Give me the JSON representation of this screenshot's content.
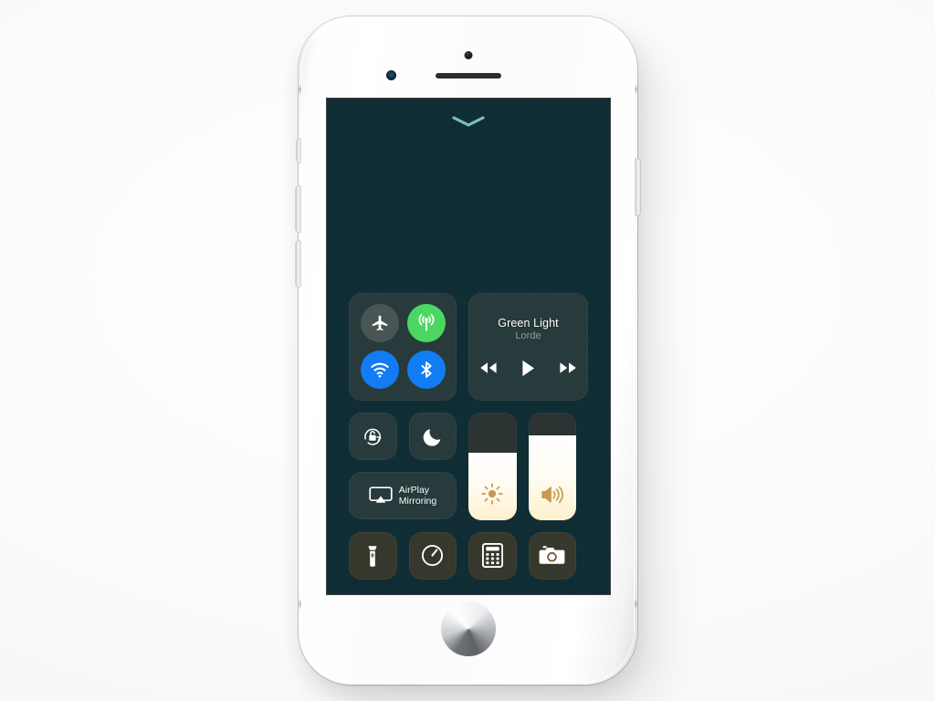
{
  "device": {
    "name": "iPhone",
    "finish": "silver-white",
    "components": {
      "front_camera": "front-camera",
      "earpiece": "earpiece-speaker",
      "proximity_sensor": "proximity-sensor",
      "home_button": "home-button",
      "power_button": "power-button",
      "volume_up_button": "volume-up-button",
      "volume_down_button": "volume-down-button",
      "silent_switch": "silent-switch"
    }
  },
  "screen": {
    "wallpaper_colors": {
      "top": "#0f2f38",
      "upper_mid": "#18565a",
      "mid": "#2a6f5e",
      "lower_mid": "#bb9a62",
      "bottom": "#d9a757"
    },
    "handle": {
      "name": "control-center-handle",
      "shape": "chevron-down",
      "color": "#7fc9bd"
    }
  },
  "control_center": {
    "connectivity": {
      "tile_name": "connectivity-tile",
      "buttons": [
        {
          "id": "airplane-mode",
          "label": "Airplane Mode",
          "icon": "airplane-icon",
          "state": "off",
          "color": "#78807866"
        },
        {
          "id": "cellular-data",
          "label": "Cellular Data",
          "icon": "cellular-antenna-icon",
          "state": "on",
          "color": "#4cd763"
        },
        {
          "id": "wifi",
          "label": "Wi-Fi",
          "icon": "wifi-icon",
          "state": "on",
          "color": "#127cf4"
        },
        {
          "id": "bluetooth",
          "label": "Bluetooth",
          "icon": "bluetooth-icon",
          "state": "on",
          "color": "#127cf4"
        }
      ]
    },
    "now_playing": {
      "tile_name": "now-playing-tile",
      "title": "Green Light",
      "artist": "Lorde",
      "controls": [
        {
          "id": "rewind",
          "label": "Rewind",
          "icon": "rewind-icon"
        },
        {
          "id": "play",
          "label": "Play",
          "icon": "play-icon"
        },
        {
          "id": "fast-forward",
          "label": "Fast Forward",
          "icon": "fast-forward-icon"
        }
      ]
    },
    "toggles": [
      {
        "id": "rotation-lock",
        "label": "Portrait Orientation Lock",
        "icon": "rotation-lock-icon",
        "state": "on"
      },
      {
        "id": "do-not-disturb",
        "label": "Do Not Disturb",
        "icon": "moon-icon",
        "state": "off"
      }
    ],
    "airplay": {
      "tile_name": "airplay-mirroring-tile",
      "line1": "AirPlay",
      "line2": "Mirroring",
      "icon": "airplay-icon"
    },
    "sliders": [
      {
        "id": "brightness",
        "label": "Brightness",
        "icon": "brightness-sun-icon",
        "value_percent": 62
      },
      {
        "id": "volume",
        "label": "Volume",
        "icon": "volume-speaker-icon",
        "value_percent": 78
      }
    ],
    "shortcuts": [
      {
        "id": "flashlight",
        "label": "Flashlight",
        "icon": "flashlight-icon"
      },
      {
        "id": "timer",
        "label": "Timer",
        "icon": "timer-icon"
      },
      {
        "id": "calculator",
        "label": "Calculator",
        "icon": "calculator-icon"
      },
      {
        "id": "camera",
        "label": "Camera",
        "icon": "camera-icon"
      }
    ]
  }
}
